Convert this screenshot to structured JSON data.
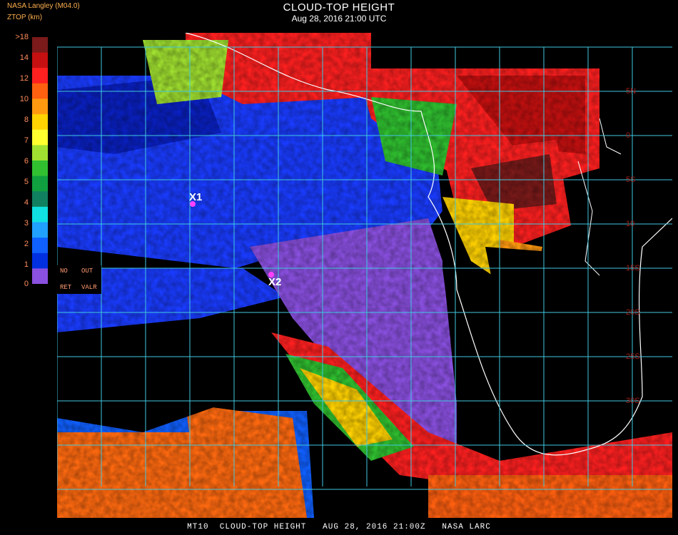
{
  "header": {
    "title": "CLOUD-TOP HEIGHT",
    "subtitle": "Aug 28, 2016 21:00 UTC",
    "org": "NASA Langley (M04.0)",
    "units": "ZTOP (km)"
  },
  "colorbar": {
    "labels": [
      ">18",
      "14",
      "12",
      "10",
      "8",
      "7",
      "6",
      "5",
      "4",
      "3",
      "2",
      "1",
      "0"
    ],
    "colors": [
      "#7a1a1a",
      "#c41010",
      "#ff2020",
      "#ff6010",
      "#ff9a10",
      "#ffd200",
      "#ffff30",
      "#a0e030",
      "#30c030",
      "#10a040",
      "#108060",
      "#10e0e0",
      "#20a0ff",
      "#1060ff",
      "#0030e0",
      "#8a50e0"
    ]
  },
  "legend": {
    "no": "NO",
    "out": "OUT",
    "ret": "RET",
    "valr": "VALR"
  },
  "markers": [
    {
      "label": "X1"
    },
    {
      "label": "X2"
    }
  ],
  "lat_labels": [
    "5N",
    "0",
    "5S",
    "10",
    "15S",
    "20S",
    "25S",
    "30S"
  ],
  "footer": "MT10  CLOUD-TOP HEIGHT   AUG 28, 2016 21:00Z   NASA LARC",
  "colors": {
    "background": "#000000",
    "grid": "#40c8e0",
    "coast": "#ffffff",
    "label_orange": "#ffb050",
    "low_purple": "#8a50e0",
    "mid_blue": "#1a3cff",
    "high_red": "#ff2020",
    "sea_orange": "#ff6a10"
  }
}
